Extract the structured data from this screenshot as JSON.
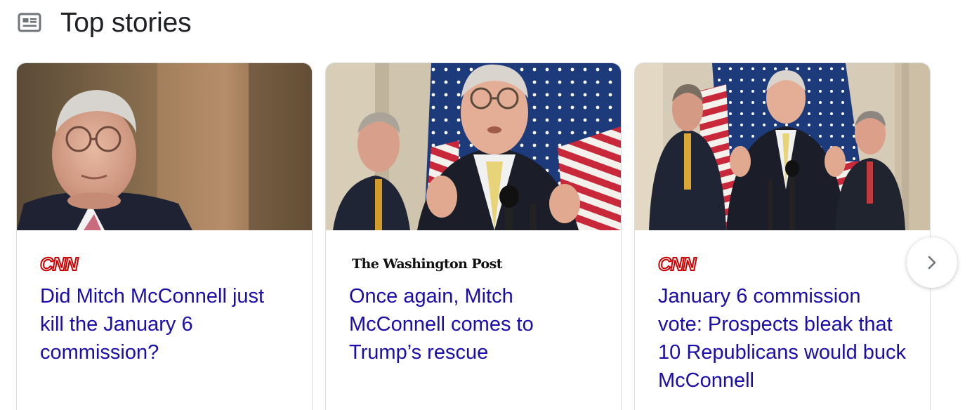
{
  "header": {
    "icon": "news-icon",
    "title": "Top stories"
  },
  "stories": [
    {
      "source": "CNN",
      "headline": "Did Mitch McConnell just kill the January 6 commission?"
    },
    {
      "source": "The Washington Post",
      "headline": "Once again, Mitch McConnell comes to Trump’s rescue"
    },
    {
      "source": "CNN",
      "headline": "January 6 commission vote: Prospects bleak that 10 Republicans would buck McConnell"
    }
  ],
  "navigation": {
    "next_icon": "chevron-right-icon"
  },
  "colors": {
    "headline_link": "#1a0dab",
    "cnn_red": "#cc0000",
    "card_border": "#dadce0"
  }
}
